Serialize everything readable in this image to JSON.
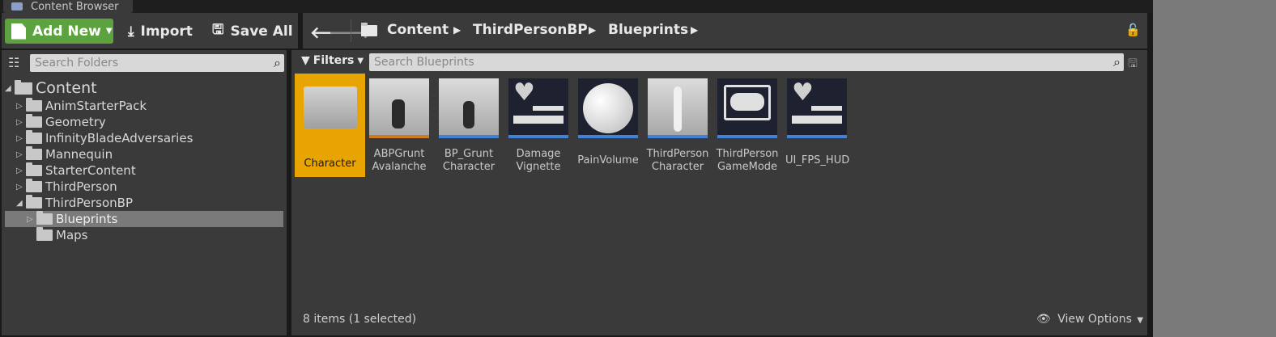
{
  "tab": {
    "title": "Content Browser"
  },
  "toolbar": {
    "add_new": "Add New",
    "import": "Import",
    "save_all": "Save All"
  },
  "breadcrumb": [
    "Content",
    "ThirdPersonBP",
    "Blueprints"
  ],
  "sidebar": {
    "search_placeholder": "Search Folders",
    "tree": [
      {
        "label": "Content"
      },
      {
        "label": "AnimStarterPack"
      },
      {
        "label": "Geometry"
      },
      {
        "label": "InfinityBladeAdversaries"
      },
      {
        "label": "Mannequin"
      },
      {
        "label": "StarterContent"
      },
      {
        "label": "ThirdPerson"
      },
      {
        "label": "ThirdPersonBP"
      },
      {
        "label": "Blueprints"
      },
      {
        "label": "Maps"
      }
    ]
  },
  "content": {
    "filters_label": "Filters",
    "search_placeholder": "Search Blueprints",
    "items": [
      {
        "l1": "Character",
        "l2": ""
      },
      {
        "l1": "ABPGrunt",
        "l2": "Avalanche"
      },
      {
        "l1": "BP_Grunt",
        "l2": "Character"
      },
      {
        "l1": "Damage",
        "l2": "Vignette"
      },
      {
        "l1": "PainVolume",
        "l2": ""
      },
      {
        "l1": "ThirdPerson",
        "l2": "Character"
      },
      {
        "l1": "ThirdPerson",
        "l2": "GameMode"
      },
      {
        "l1": "UI_FPS_HUD",
        "l2": ""
      }
    ],
    "status": "8 items (1 selected)",
    "view_options": "View Options"
  },
  "colors": {
    "add_new_bg": "#5ca33f",
    "selection": "#e8a400",
    "accent_blue": "#3f82d8"
  }
}
